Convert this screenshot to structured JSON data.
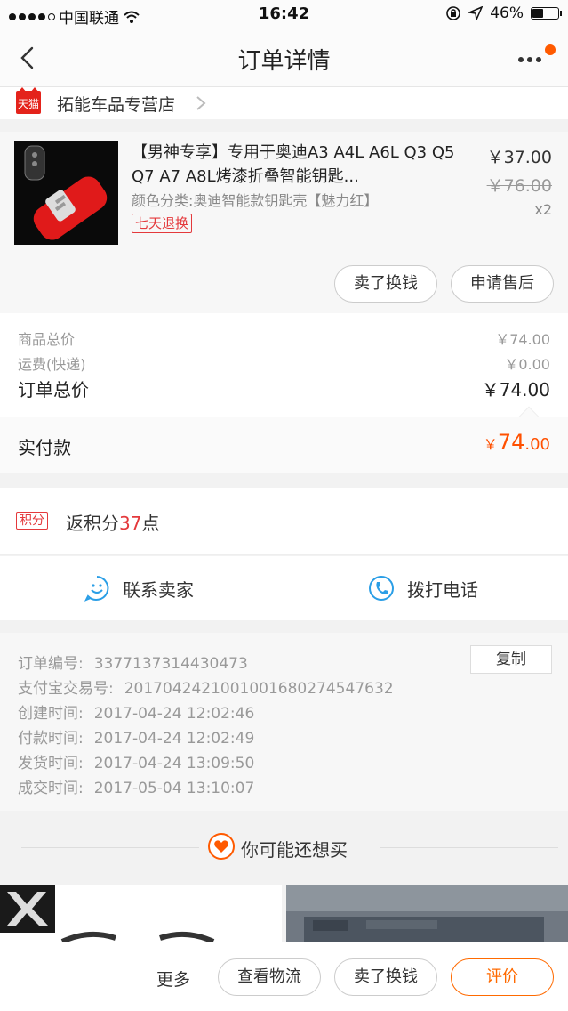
{
  "status_bar": {
    "carrier": "中国联通",
    "time": "16:42",
    "battery": "46%",
    "battery_level": 0.46
  },
  "nav": {
    "title": "订单详情"
  },
  "shop": {
    "badge": "天猫",
    "name": "拓能车品专营店"
  },
  "product": {
    "title": "【男神专享】专用于奥迪A3 A4L A6L Q3 Q5 Q7 A7 A8L烤漆折叠智能钥匙...",
    "variant": "颜色分类:奥迪智能款钥匙壳【魅力红】",
    "tag": "七天退换",
    "price": "￥37.00",
    "original_price": "￥76.00",
    "quantity": "x2",
    "actions": [
      "卖了换钱",
      "申请售后"
    ]
  },
  "summary": {
    "goods_total_label": "商品总价",
    "goods_total": "￥74.00",
    "shipping_label": "运费(快递)",
    "shipping": "￥0.00",
    "order_total_label": "订单总价",
    "order_total": "￥74.00"
  },
  "payment": {
    "label": "实付款",
    "currency": "￥",
    "int": "74",
    "dec": ".00"
  },
  "points": {
    "badge": "积分",
    "prefix": "返积分",
    "value": "37",
    "suffix": "点"
  },
  "contact": {
    "seller": "联系卖家",
    "phone": "拨打电话"
  },
  "order_info": {
    "copy_label": "复制",
    "rows": [
      {
        "label": "订单编号:",
        "value": "3377137314430473"
      },
      {
        "label": "支付宝交易号:",
        "value": "2017042421001001680274547632"
      },
      {
        "label": "创建时间:",
        "value": "2017-04-24 12:02:46"
      },
      {
        "label": "付款时间:",
        "value": "2017-04-24 12:02:49"
      },
      {
        "label": "发货时间:",
        "value": "2017-04-24 13:09:50"
      },
      {
        "label": "成交时间:",
        "value": "2017-05-04 13:10:07"
      }
    ]
  },
  "recommend": {
    "title": "你可能还想买"
  },
  "bottom_bar": {
    "more": "更多",
    "logistics": "查看物流",
    "resell": "卖了换钱",
    "review": "评价"
  },
  "colors": {
    "accent_orange": "#ff5000",
    "tag_red": "#e4393c",
    "tmall_red": "#e4231b"
  }
}
